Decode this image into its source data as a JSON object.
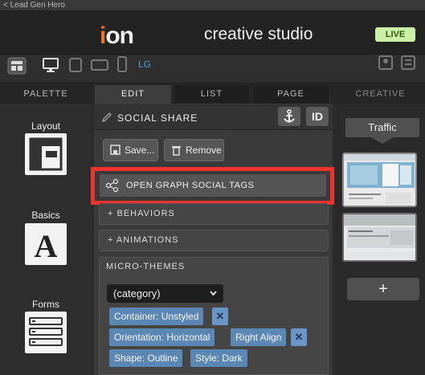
{
  "breadcrumb": "< Lead Gen Hero",
  "header": {
    "logo_prefix": "i",
    "logo_rest": "on",
    "studio": "creative studio",
    "live": "LIVE"
  },
  "toolbar": {
    "icons": [
      "layout-icon",
      "desktop-icon",
      "tablet-icon",
      "tablet-landscape-icon",
      "phone-icon",
      "preview-icon"
    ],
    "breakpoint": "LG"
  },
  "tabs": {
    "palette": "PALETTE",
    "edit": "EDIT",
    "list": "LIST",
    "page": "PAGE",
    "creative": "CREATIVE"
  },
  "palette": {
    "items": [
      {
        "label": "Layout",
        "icon": "layout-grid-icon"
      },
      {
        "label": "Basics",
        "icon": "letter-a-icon"
      },
      {
        "label": "Forms",
        "icon": "form-list-icon"
      }
    ]
  },
  "edit": {
    "title": "SOCIAL SHARE",
    "anchor_icon": "anchor-icon",
    "id_label": "ID",
    "save": "Save...",
    "remove": "Remove",
    "og_tags": "OPEN GRAPH SOCIAL TAGS",
    "behaviors": "+ BEHAVIORS",
    "animations": "+ ANIMATIONS",
    "micro_themes": "MICRO-THEMES",
    "category": "(category)",
    "chips": {
      "container": "Container: Unstyled",
      "orientation": "Orientation: Horizontal",
      "right_align": "Right Align",
      "shape": "Shape: Outline",
      "style": "Style: Dark"
    },
    "chip_remove": "✕"
  },
  "creative": {
    "traffic": "Traffic",
    "add": "+",
    "thumb1_headline": "Your Great Headline Here",
    "thumb2_headline": "Thank You"
  },
  "colors": {
    "accent_orange": "#e87722",
    "live_bg": "#c9f0a4",
    "highlight_red": "#f0332a",
    "chip_blue": "#5b87b4",
    "link_blue": "#4aa3df"
  }
}
